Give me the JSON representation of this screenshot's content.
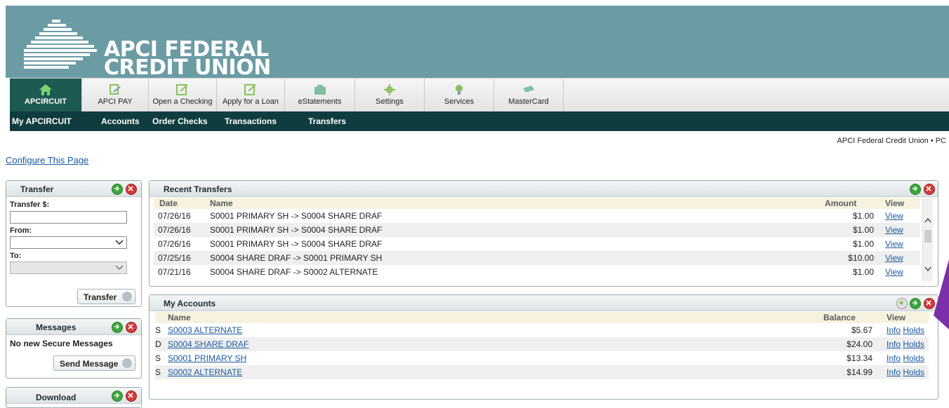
{
  "brand": {
    "line1": "APCI FEDERAL",
    "line2": "CREDIT UNION"
  },
  "colors": {
    "header": "#6b9ca4",
    "active_tab": "#1d5a52",
    "subnav": "#0f3d3f",
    "link": "#1a5aa0"
  },
  "tabs": [
    {
      "label": "APCIRCUIT",
      "icon": "home-icon",
      "active": true
    },
    {
      "label": "APCI PAY",
      "icon": "pay-icon"
    },
    {
      "label": "Open a Checking",
      "icon": "edit-icon"
    },
    {
      "label": "Apply for a Loan",
      "icon": "edit-icon"
    },
    {
      "label": "eStatements",
      "icon": "statement-icon"
    },
    {
      "label": "Settings",
      "icon": "gear-icon"
    },
    {
      "label": "Services",
      "icon": "lightbulb-icon"
    },
    {
      "label": "MasterCard",
      "icon": "card-icon"
    }
  ],
  "subnav": [
    "My APCIRCUIT",
    "Accounts",
    "Order Checks",
    "Transactions",
    "Transfers"
  ],
  "org_text": "APCI Federal Credit Union • PC",
  "configure_link": "Configure This Page",
  "transfer_panel": {
    "title": "Transfer",
    "amount_label": "Transfer $:",
    "from_label": "From:",
    "to_label": "To:",
    "button": "Transfer"
  },
  "messages_panel": {
    "title": "Messages",
    "status": "No new Secure Messages",
    "button": "Send Message"
  },
  "download_panel": {
    "title": "Download"
  },
  "recent_transfers": {
    "title": "Recent Transfers",
    "headers": {
      "date": "Date",
      "name": "Name",
      "amount": "Amount",
      "view": "View"
    },
    "rows": [
      {
        "date": "07/26/16",
        "name": "S0001 PRIMARY SH -> S0004 SHARE DRAF",
        "amount": "$1.00",
        "view": "View"
      },
      {
        "date": "07/26/16",
        "name": "S0001 PRIMARY SH -> S0004 SHARE DRAF",
        "amount": "$1.00",
        "view": "View"
      },
      {
        "date": "07/26/16",
        "name": "S0001 PRIMARY SH -> S0004 SHARE DRAF",
        "amount": "$1.00",
        "view": "View"
      },
      {
        "date": "07/25/16",
        "name": "S0004 SHARE DRAF -> S0001 PRIMARY SH",
        "amount": "$10.00",
        "view": "View"
      },
      {
        "date": "07/21/16",
        "name": "S0004 SHARE DRAF -> S0002 ALTERNATE",
        "amount": "$1.00",
        "view": "View"
      }
    ]
  },
  "my_accounts": {
    "title": "My Accounts",
    "headers": {
      "name": "Name",
      "balance": "Balance",
      "view": "View"
    },
    "rows": [
      {
        "type": "S",
        "name": "S0003 ALTERNATE",
        "balance": "$5.67",
        "info": "Info",
        "holds": "Holds"
      },
      {
        "type": "D",
        "name": "S0004 SHARE DRAF",
        "balance": "$24.00",
        "info": "Info",
        "holds": "Holds"
      },
      {
        "type": "S",
        "name": "S0001 PRIMARY SH",
        "balance": "$13.34",
        "info": "Info",
        "holds": "Holds"
      },
      {
        "type": "S",
        "name": "S0002 ALTERNATE",
        "balance": "$14.99",
        "info": "Info",
        "holds": "Holds"
      }
    ]
  }
}
